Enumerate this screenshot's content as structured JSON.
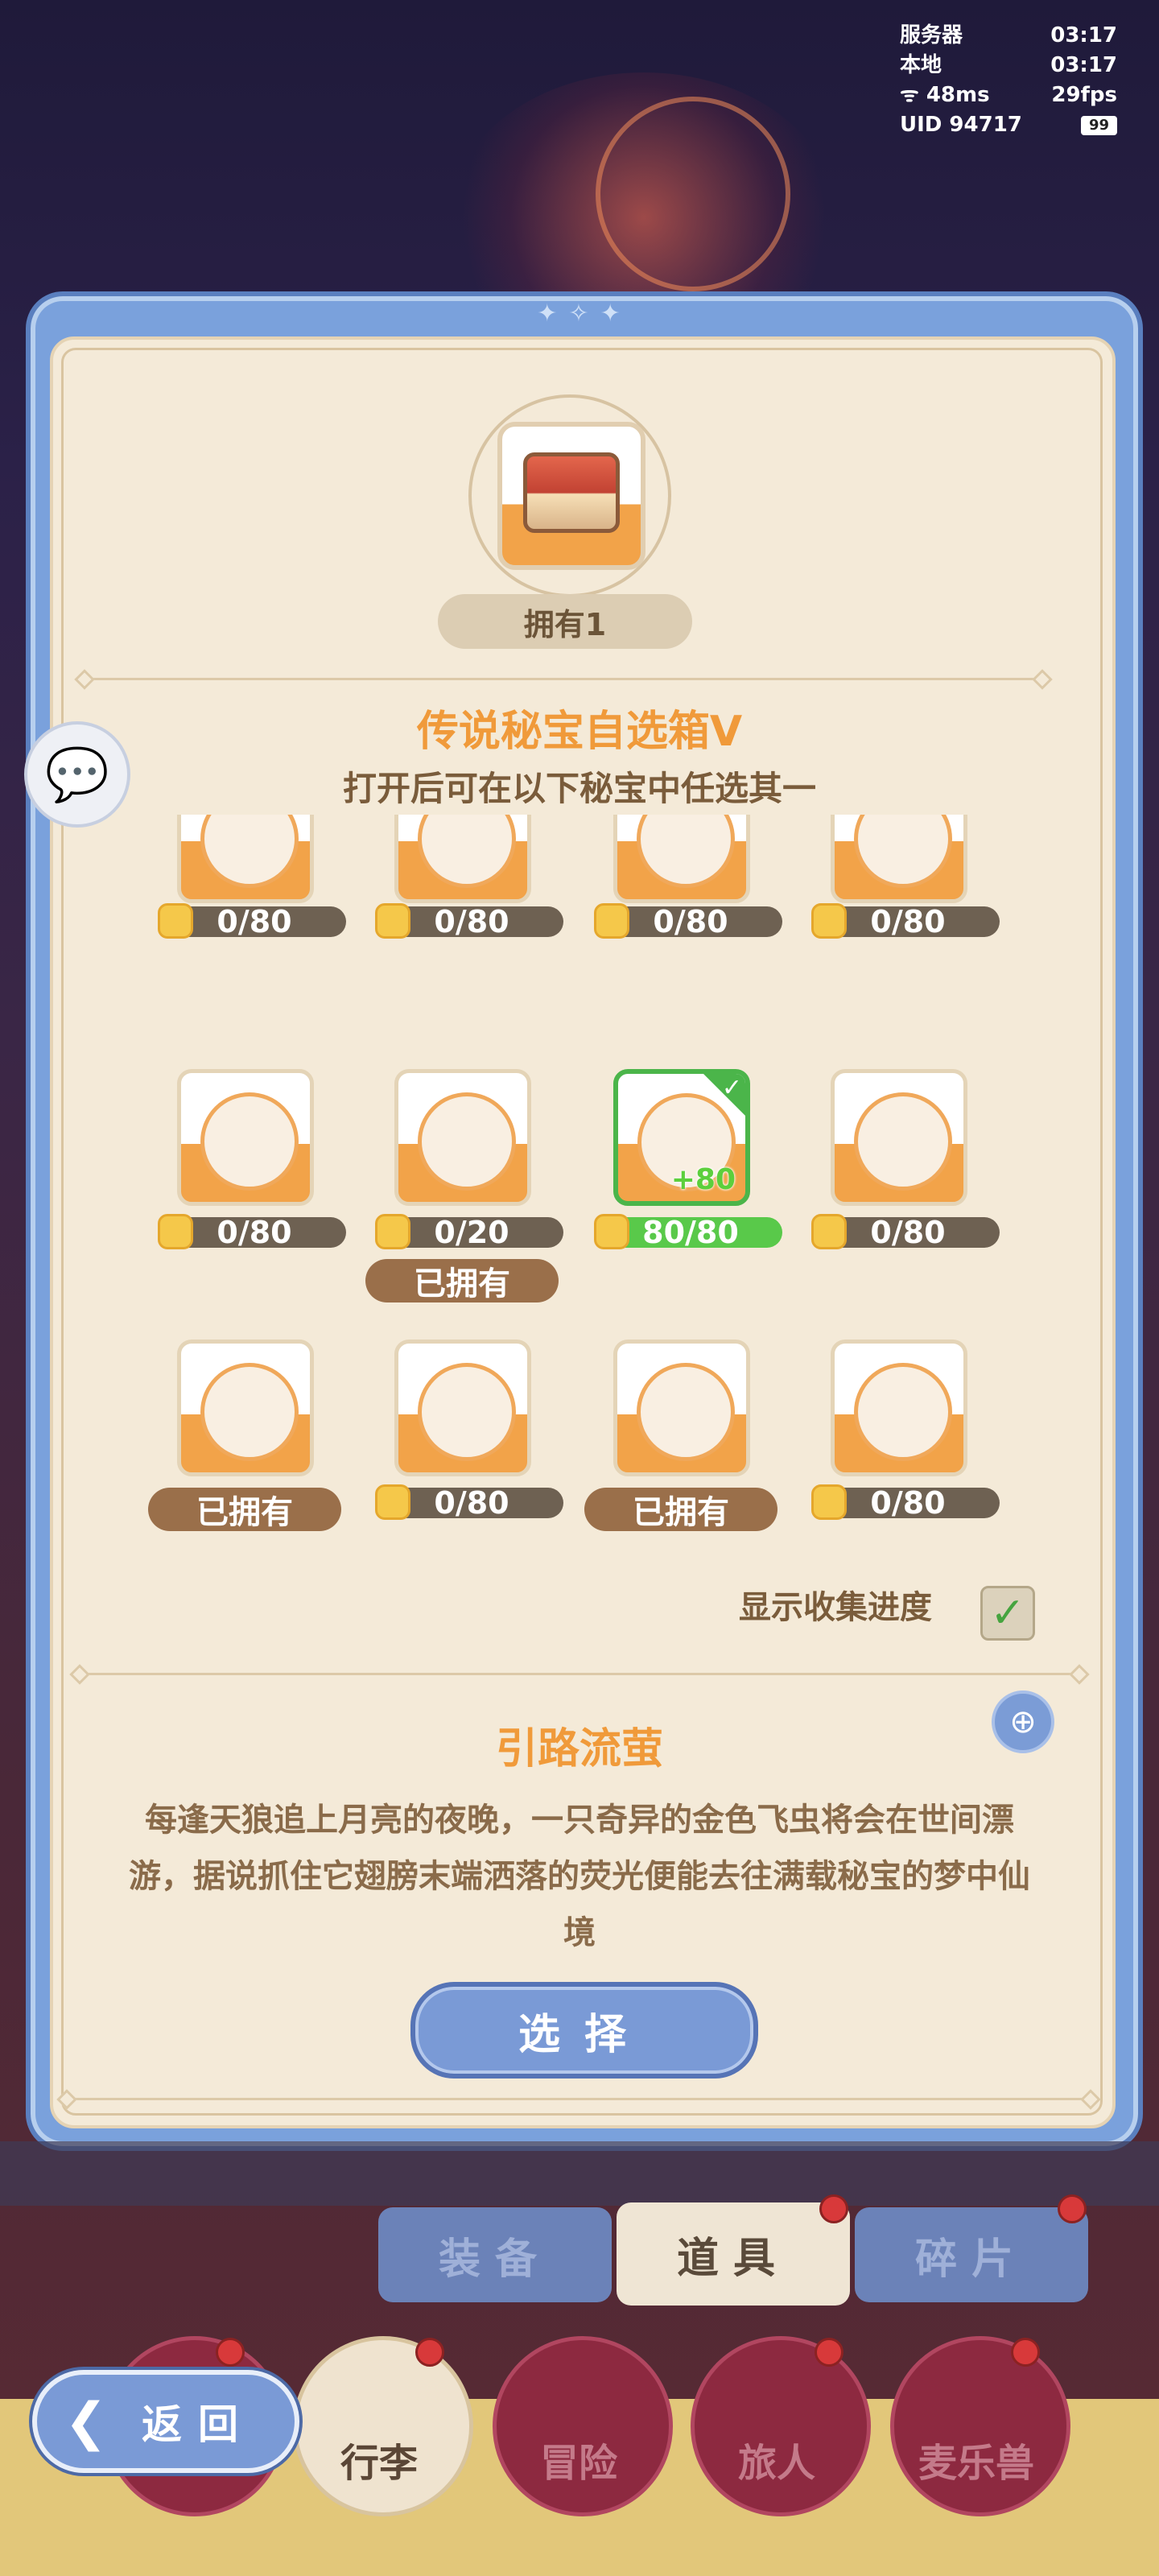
{
  "hud": {
    "server_label": "服务器",
    "server_time": "03:17",
    "local_label": "本地",
    "local_time": "03:17",
    "ping": "48ms",
    "fps": "29fps",
    "uid": "UID 94717",
    "battery": "99"
  },
  "modal": {
    "owned": "拥有1",
    "title": "传说秘宝自选箱V",
    "subtitle": "打开后可在以下秘宝中任选其一"
  },
  "items": [
    {
      "progress": "0/80"
    },
    {
      "progress": "0/80"
    },
    {
      "progress": "0/80"
    },
    {
      "progress": "0/80"
    },
    {
      "progress": "0/80"
    },
    {
      "progress": "0/20",
      "owned_label": "已拥有"
    },
    {
      "progress": "80/80",
      "bonus": "+80",
      "selected": true
    },
    {
      "progress": "0/80"
    },
    {
      "owned_label": "已拥有"
    },
    {
      "progress": "0/80"
    },
    {
      "owned_label": "已拥有"
    },
    {
      "progress": "0/80"
    }
  ],
  "toggle": {
    "label": "显示收集进度",
    "checked": true
  },
  "detail": {
    "name": "引路流萤",
    "description": "每逢天狼追上月亮的夜晚，一只奇异的金色飞虫将会在世间漂游，据说抓住它翅膀末端洒落的荧光便能去往满载秘宝的梦中仙境"
  },
  "select_button": "选择",
  "tabs": [
    {
      "label": "装备"
    },
    {
      "label": "道具"
    },
    {
      "label": "碎片"
    }
  ],
  "nav": [
    {
      "label": "行李"
    },
    {
      "label": "冒险"
    },
    {
      "label": "旅人"
    },
    {
      "label": "麦乐兽"
    }
  ],
  "back_button": "返回",
  "colors": {
    "accent_orange": "#f09a3a",
    "modal_blue": "#7aa1dc",
    "selected_green": "#4bb54a",
    "parchment": "#f4ead8"
  }
}
